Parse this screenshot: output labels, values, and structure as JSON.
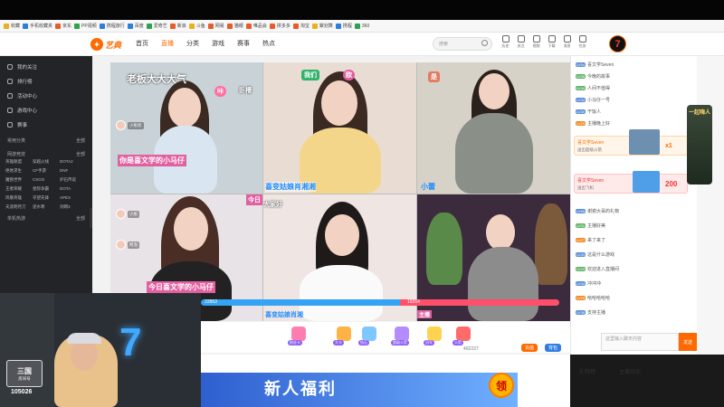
{
  "bookmarks": [
    {
      "label": "收藏",
      "color": "#e8b21e"
    },
    {
      "label": "手机收藏夹",
      "color": "#2f7de1"
    },
    {
      "label": "京东",
      "color": "#e85c2a"
    },
    {
      "label": "PP视频",
      "color": "#2fa24b"
    },
    {
      "label": "携程旅行",
      "color": "#2f7de1"
    },
    {
      "label": "百度",
      "color": "#2f7de1"
    },
    {
      "label": "爱奇艺",
      "color": "#2fa24b"
    },
    {
      "label": "新浪",
      "color": "#e85c2a"
    },
    {
      "label": "斗鱼",
      "color": "#e8b21e"
    },
    {
      "label": "网易",
      "color": "#e85c2a"
    },
    {
      "label": "猫眼",
      "color": "#e85c2a"
    },
    {
      "label": "唯品会",
      "color": "#e85c2a"
    },
    {
      "label": "拼多多",
      "color": "#e85c2a"
    },
    {
      "label": "淘宝",
      "color": "#e85c2a"
    },
    {
      "label": "聚划算",
      "color": "#e8b21e"
    },
    {
      "label": "携程",
      "color": "#2f7de1"
    },
    {
      "label": "360",
      "color": "#2fa24b"
    }
  ],
  "header": {
    "logo": "艺典",
    "nav": [
      "首页",
      "直播",
      "分类",
      "游戏",
      "赛事",
      "热点"
    ],
    "active_nav": 1,
    "search_placeholder": "搜索",
    "icons": [
      {
        "name": "history-icon",
        "label": "历史"
      },
      {
        "name": "follow-icon",
        "label": "关注"
      },
      {
        "name": "video-icon",
        "label": "视频"
      },
      {
        "name": "download-icon",
        "label": "下载"
      },
      {
        "name": "message-icon",
        "label": "消息"
      },
      {
        "name": "task-icon",
        "label": "任务"
      }
    ],
    "user_avatar": "7"
  },
  "sidebar": {
    "items": [
      "我的关注",
      "排行榜",
      "活动中心",
      "游戏中心",
      "赛事"
    ],
    "section1": {
      "title": "常用分类",
      "more": "全部"
    },
    "section2": {
      "title": "网游竞技",
      "more": "全部"
    },
    "grid": [
      "英雄联盟",
      "穿越火线",
      "DOTA2",
      "绝地求生",
      "CF手游",
      "DNF",
      "魔兽世界",
      "CSGO",
      "炉石传说",
      "王者荣耀",
      "星际争霸",
      "DOTA",
      "风暴英雄",
      "守望先锋",
      "APEX",
      "天涯明月刀",
      "逆水寒",
      "剑网3"
    ],
    "section3": {
      "title": "单机热游",
      "more": "全部"
    },
    "toggle": "‹"
  },
  "streams": {
    "overlay_texts": [
      "老板大大大气",
      "咔",
      "卧槽",
      "欧",
      "我们",
      "是",
      "主播",
      "今日",
      "大家好"
    ],
    "name_chips": [
      "我是文学的小马仔",
      "小彤",
      "小萱",
      "小彤彤",
      "阿泡",
      "主播"
    ],
    "captions": [
      "你是喜文学的小马仔",
      "喜变姑娘肖湘湘",
      "今日喜文学的小马仔",
      "大家下午好",
      "小蕾",
      "喜变姑娘肖湘",
      "主播"
    ],
    "pk": {
      "left_label": "22863",
      "right_label": "19264"
    }
  },
  "gifts": {
    "labels": [
      "粉丝卡",
      "大卡",
      "钻石",
      "超级火箭",
      "冠军",
      "火箭"
    ],
    "count": "492227",
    "buttons": [
      "充值",
      "背包"
    ]
  },
  "lower": {
    "banner_text": "新人福利",
    "coin_label": "领",
    "tabs": [
      "礼物榜",
      "主播动态"
    ]
  },
  "chat": {
    "lines": [
      {
        "lvl": "LV54",
        "lvlcolor": "lvl",
        "text": "喜文学Seven"
      },
      {
        "lvl": "LV38",
        "lvlcolor": "g",
        "text": "今晚的故事"
      },
      {
        "lvl": "LV44",
        "lvlcolor": "g",
        "text": "人间不值得"
      },
      {
        "lvl": "LV32",
        "lvlcolor": "lvl",
        "text": "小马仔一号"
      },
      {
        "lvl": "LV30",
        "lvlcolor": "lvl",
        "text": "干饭人"
      },
      {
        "lvl": "LV29",
        "lvlcolor": "o",
        "text": "主播晚上好"
      }
    ],
    "card1": {
      "title": "喜文学Seven",
      "sub": "送出超级火箭",
      "amount": "x1"
    },
    "card2": {
      "title": "喜文学Seven",
      "sub": "送出飞机",
      "amount": "200"
    },
    "lines2": [
      {
        "lvl": "LV66",
        "lvlcolor": "lvl",
        "text": "谢谢大哥的礼物"
      },
      {
        "lvl": "LV31",
        "lvlcolor": "g",
        "text": "主播好美"
      },
      {
        "lvl": "LV27",
        "lvlcolor": "o",
        "text": "来了来了"
      },
      {
        "lvl": "LV33",
        "lvlcolor": "lvl",
        "text": "这是什么游戏"
      },
      {
        "lvl": "LV23",
        "lvlcolor": "g",
        "text": "欢迎进入直播间"
      },
      {
        "lvl": "LV44",
        "lvlcolor": "lvl",
        "text": "冲冲冲"
      },
      {
        "lvl": "LV23",
        "lvlcolor": "o",
        "text": "哈哈哈哈哈"
      },
      {
        "lvl": "LV36",
        "lvlcolor": "lvl",
        "text": "支持主播"
      }
    ],
    "input_placeholder": "这里输入聊天内容",
    "send": "发送"
  },
  "rank_badge": "一起嗨人",
  "cam": {
    "logo_top": "三国",
    "logo_bottom": "房间号",
    "room_id": "105026"
  }
}
